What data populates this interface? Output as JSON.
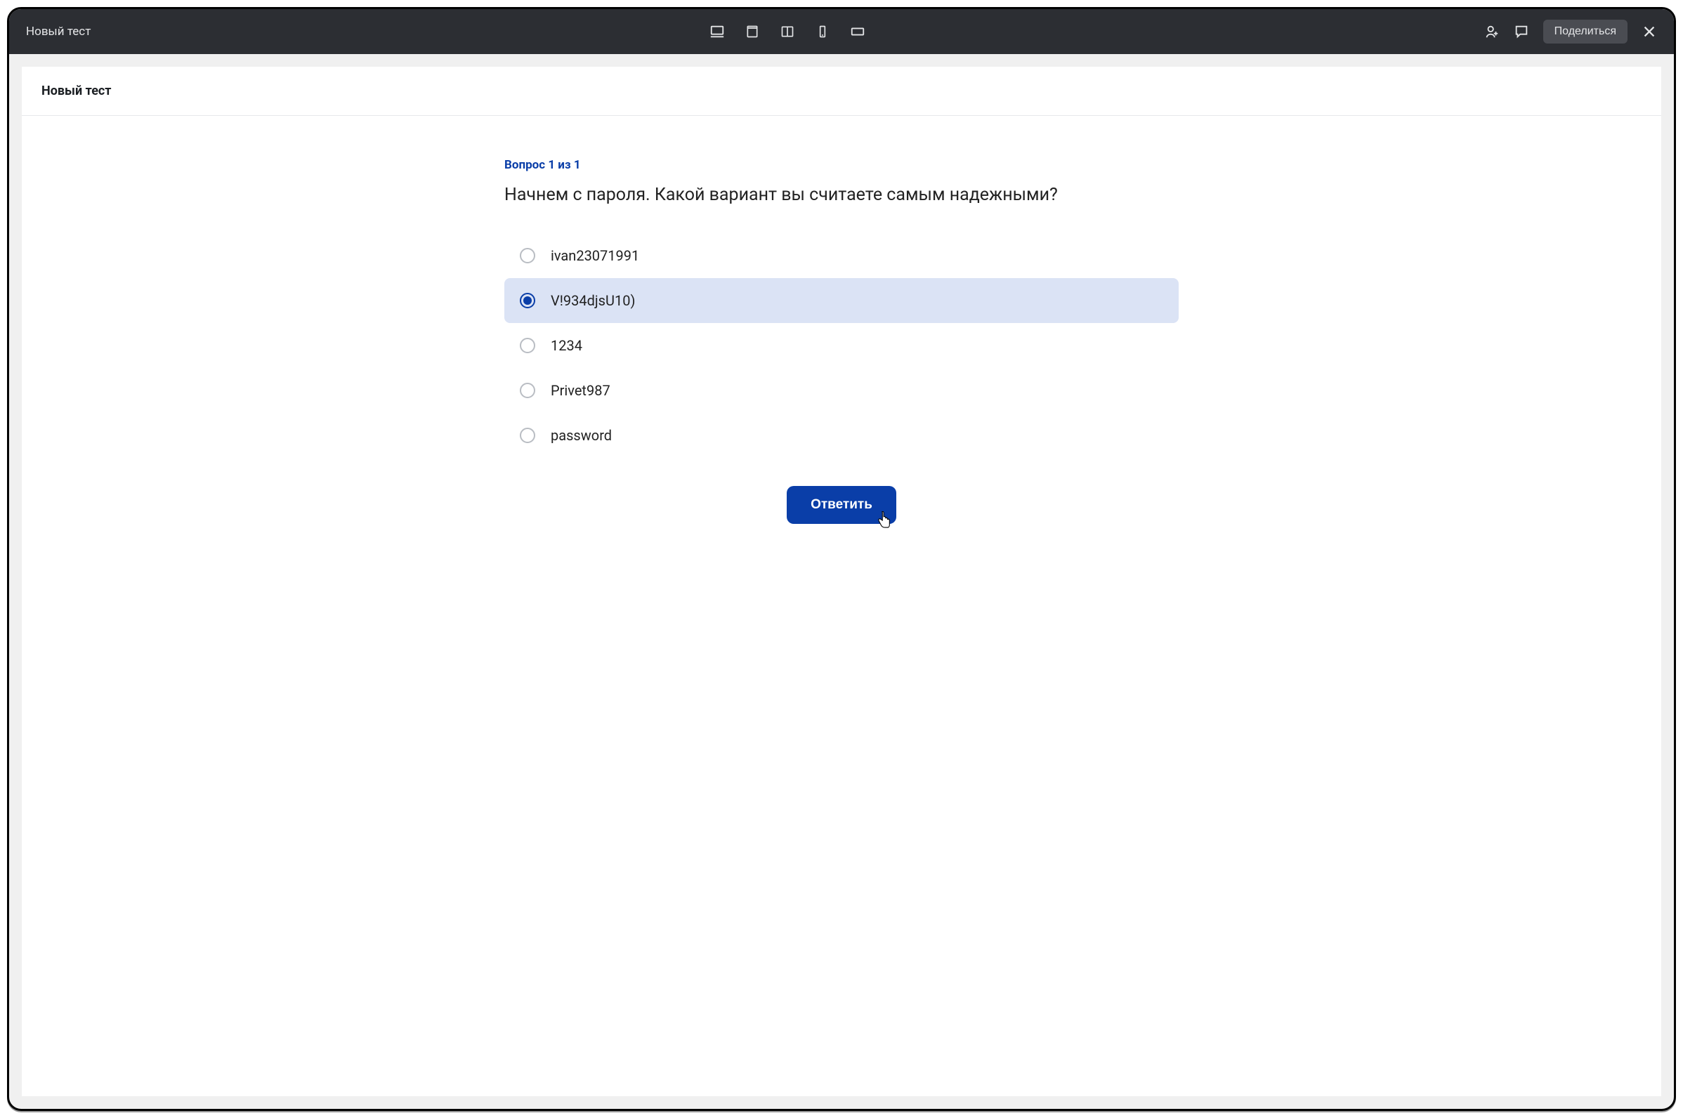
{
  "topbar": {
    "title": "Новый тест",
    "share_label": "Поделиться"
  },
  "page": {
    "header_title": "Новый тест"
  },
  "question": {
    "counter": "Вопрос 1 из 1",
    "text": "Начнем с пароля. Какой вариант вы считаете самым надежными?",
    "options": [
      {
        "label": "ivan23071991",
        "selected": false
      },
      {
        "label": "V!934djsU10)",
        "selected": true
      },
      {
        "label": "1234",
        "selected": false
      },
      {
        "label": "Privet987",
        "selected": false
      },
      {
        "label": "password",
        "selected": false
      }
    ],
    "submit_label": "Ответить"
  }
}
